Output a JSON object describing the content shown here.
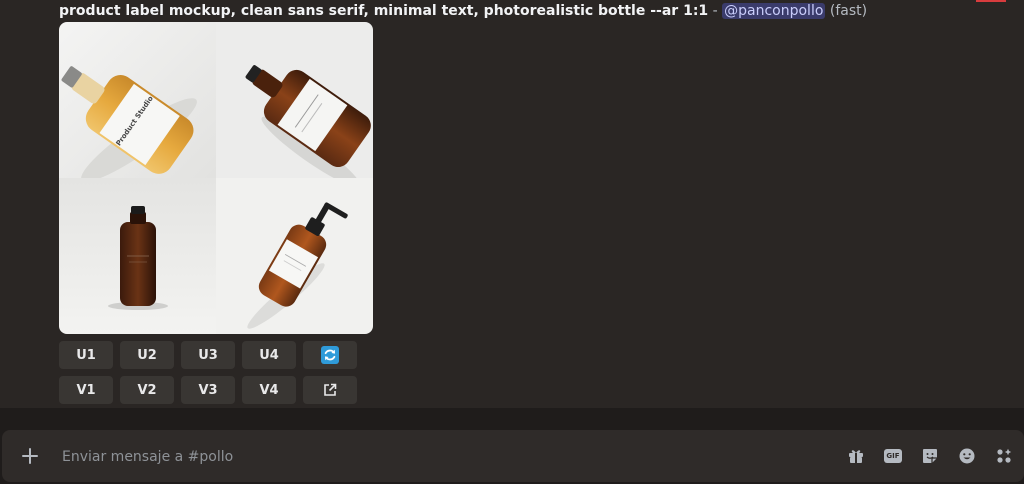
{
  "message": {
    "prompt": "product label mockup, clean sans serif, minimal text, photorealistic bottle --ar 1:1",
    "separator": "-",
    "mention": "@panconpollo",
    "mode": "(fast)"
  },
  "images": {
    "panels": [
      "bottle-mockup-1",
      "bottle-mockup-2",
      "bottle-mockup-3",
      "bottle-mockup-4"
    ],
    "label_text": "Product Studio"
  },
  "actions": {
    "upscale": [
      "U1",
      "U2",
      "U3",
      "U4"
    ],
    "variation": [
      "V1",
      "V2",
      "V3",
      "V4"
    ],
    "reroll_icon": "refresh-icon",
    "open_icon": "external-link-icon",
    "reroll_color": "#2f9bd9"
  },
  "composer": {
    "placeholder": "Enviar mensaje a #pollo",
    "plus_icon": "plus-icon",
    "icons": [
      "gift-icon",
      "gif-icon",
      "sticker-icon",
      "emoji-icon",
      "apps-icon"
    ],
    "gif_text": "GIF"
  },
  "colors": {
    "background": "#2a2624",
    "composer": "#2f2b29",
    "mention_bg": "#3b3f8c"
  }
}
